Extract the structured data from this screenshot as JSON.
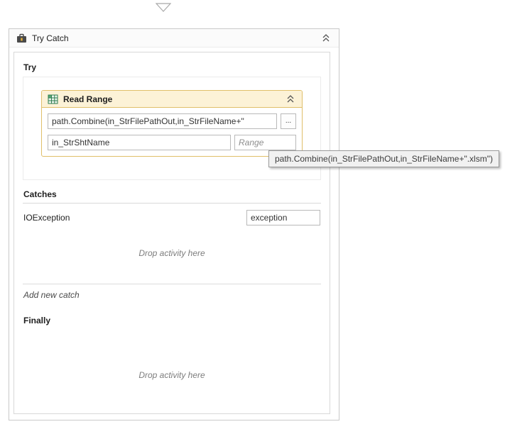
{
  "canvas": {
    "collapse_arrow": "expand-collapse"
  },
  "try_catch": {
    "title": "Try Catch",
    "try_label": "Try",
    "catches_label": "Catches",
    "add_new_catch_label": "Add new catch",
    "finally_label": "Finally",
    "drop_hint": "Drop activity here"
  },
  "read_range": {
    "title": "Read Range",
    "workbook_path": "path.Combine(in_StrFilePathOut,in_StrFileName+\"",
    "browse_label": "...",
    "sheet_name": "in_StrShtName",
    "range_placeholder": "Range"
  },
  "catch_row": {
    "exception_type": "IOException",
    "variable_name": "exception"
  },
  "tooltip": {
    "text": "path.Combine(in_StrFilePathOut,in_StrFileName+\".xlsm\")"
  }
}
